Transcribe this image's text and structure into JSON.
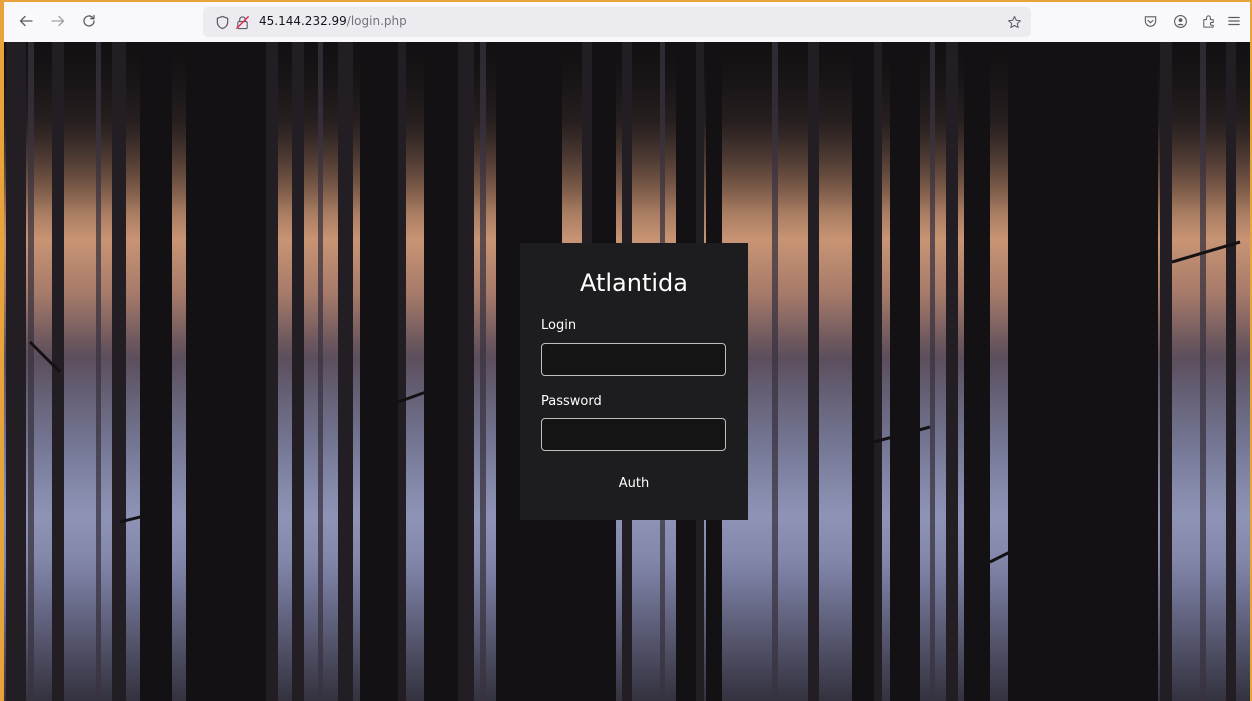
{
  "browser": {
    "url_host": "45.144.232.99",
    "url_path": "/login.php",
    "icons": {
      "back": "arrow-left-icon",
      "forward": "arrow-right-icon",
      "reload": "reload-icon",
      "tracking": "shield-icon",
      "insecure": "insecure-lock-icon",
      "bookmark": "star-icon",
      "pocket": "pocket-icon",
      "account": "account-icon",
      "extensions": "extensions-icon",
      "menu": "hamburger-menu-icon"
    },
    "accent_border": "#e8a33a"
  },
  "login": {
    "title": "Atlantida",
    "login_label": "Login",
    "login_value": "",
    "password_label": "Password",
    "password_value": "",
    "auth_label": "Auth"
  },
  "colors": {
    "card_bg": "#1d1d1f",
    "field_border": "#bfbfbf"
  }
}
